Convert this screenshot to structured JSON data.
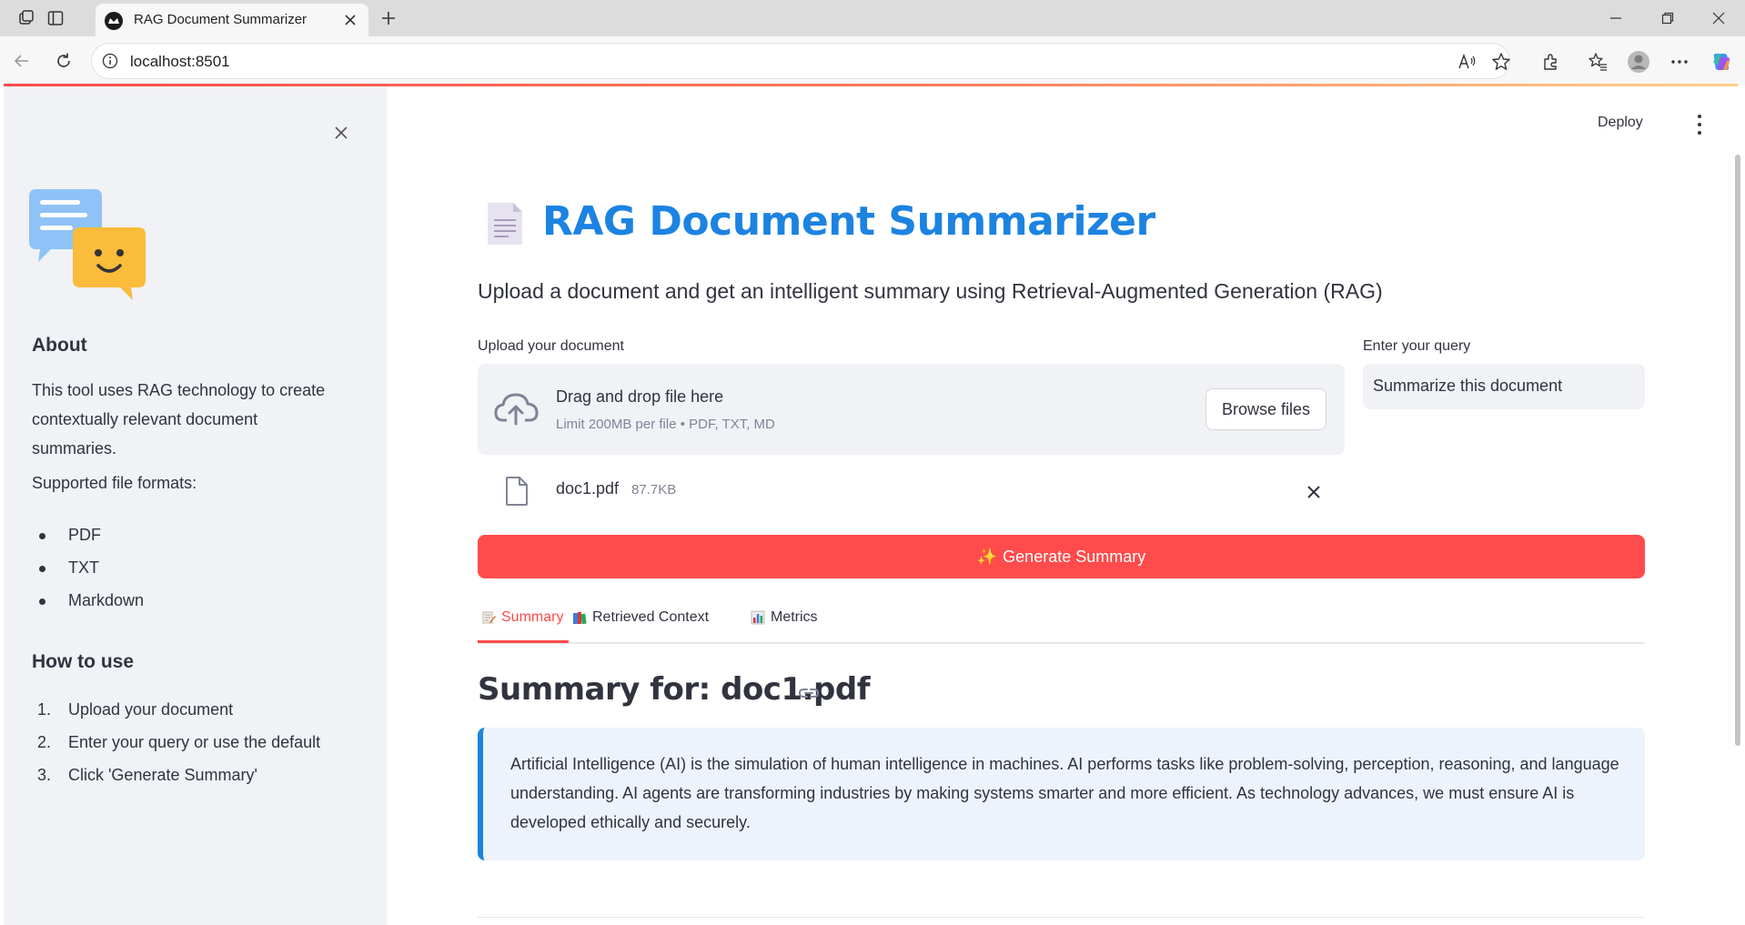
{
  "browser": {
    "tab_title": "RAG Document Summarizer",
    "url": "localhost:8501",
    "icons": [
      "workspaces-icon",
      "tab-actions-icon",
      "new-tab-icon",
      "back-icon",
      "refresh-icon",
      "site-info-icon",
      "read-aloud-icon",
      "favorite-star-icon",
      "extensions-icon",
      "favorites-icon",
      "profile-icon",
      "more-icon",
      "copilot-icon",
      "minimize-icon",
      "restore-icon",
      "close-window-icon"
    ]
  },
  "sidebar": {
    "about_heading": "About",
    "about_text": "This tool uses RAG technology to create contextually relevant document summaries.",
    "formats_label": "Supported file formats:",
    "formats": [
      "PDF",
      "TXT",
      "Markdown"
    ],
    "howto_heading": "How to use",
    "steps": [
      {
        "num": "1.",
        "text": "Upload your document"
      },
      {
        "num": "2.",
        "text": "Enter your query or use the default"
      },
      {
        "num": "3.",
        "text": "Click 'Generate Summary'"
      }
    ]
  },
  "header": {
    "deploy_label": "Deploy"
  },
  "main": {
    "title": "RAG Document Summarizer",
    "subtitle": "Upload a document and get an intelligent summary using Retrieval-Augmented Generation (RAG)",
    "upload_label": "Upload your document",
    "dropzone_title": "Drag and drop file here",
    "dropzone_limit": "Limit 200MB per file • PDF, TXT, MD",
    "browse_label": "Browse files",
    "query_label": "Enter your query",
    "query_value": "Summarize this document",
    "file_name": "doc1.pdf",
    "file_size": "87.7KB",
    "generate_label": "Generate Summary",
    "generate_emoji": "✨",
    "tabs": [
      {
        "label": "Summary",
        "icon": "memo-icon",
        "active": true
      },
      {
        "label": "Retrieved Context",
        "icon": "books-icon",
        "active": false
      },
      {
        "label": "Metrics",
        "icon": "bar-chart-icon",
        "active": false
      }
    ],
    "summary_heading": "Summary for: doc1.pdf",
    "summary_text": "Artificial Intelligence (AI) is the simulation of human intelligence in machines. AI performs tasks like problem-solving, perception, reasoning, and language understanding. AI agents are transforming industries by making systems smarter and more efficient. As technology advances, we must ensure AI is developed ethically and securely."
  },
  "colors": {
    "primary": "#ff4b4b",
    "title_blue": "#1c83e1",
    "sidebar_bg": "#f0f2f6",
    "info_bg": "#edf3fc",
    "text": "#31333f"
  }
}
